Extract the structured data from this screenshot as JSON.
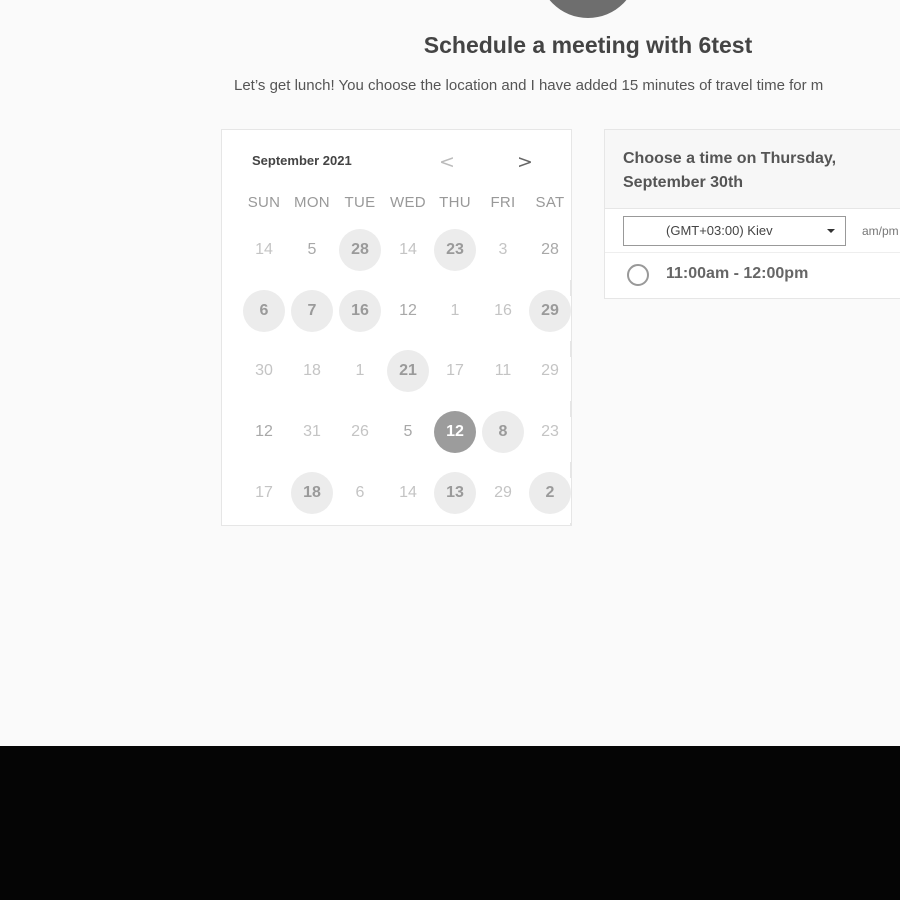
{
  "header": {
    "title": "Schedule a meeting with 6test",
    "subtitle": "Let’s get lunch! You choose the location and I have added 15 minutes of travel time for m"
  },
  "calendar": {
    "month_label": "September 2021",
    "prev_icon": "chevron-left-icon",
    "next_icon": "chevron-right-icon",
    "prev_glyph": "<",
    "next_glyph": ">",
    "weekdays": [
      "SUN",
      "MON",
      "TUE",
      "WED",
      "THU",
      "FRI",
      "SAT"
    ],
    "weeks": [
      [
        {
          "label": "14",
          "state": "muted"
        },
        {
          "label": "5",
          "state": "plain"
        },
        {
          "label": "28",
          "state": "available"
        },
        {
          "label": "14",
          "state": "muted"
        },
        {
          "label": "23",
          "state": "available"
        },
        {
          "label": "3",
          "state": "muted"
        },
        {
          "label": "28",
          "state": "plain"
        }
      ],
      [
        {
          "label": "6",
          "state": "available"
        },
        {
          "label": "7",
          "state": "available"
        },
        {
          "label": "16",
          "state": "available"
        },
        {
          "label": "12",
          "state": "plain"
        },
        {
          "label": "1",
          "state": "muted"
        },
        {
          "label": "16",
          "state": "muted"
        },
        {
          "label": "29",
          "state": "available"
        }
      ],
      [
        {
          "label": "30",
          "state": "muted"
        },
        {
          "label": "18",
          "state": "muted"
        },
        {
          "label": "1",
          "state": "muted"
        },
        {
          "label": "21",
          "state": "available"
        },
        {
          "label": "17",
          "state": "muted"
        },
        {
          "label": "11",
          "state": "muted"
        },
        {
          "label": "29",
          "state": "muted"
        }
      ],
      [
        {
          "label": "12",
          "state": "plain"
        },
        {
          "label": "31",
          "state": "muted"
        },
        {
          "label": "26",
          "state": "muted"
        },
        {
          "label": "5",
          "state": "plain"
        },
        {
          "label": "12",
          "state": "selected"
        },
        {
          "label": "8",
          "state": "available"
        },
        {
          "label": "23",
          "state": "muted"
        }
      ],
      [
        {
          "label": "17",
          "state": "muted"
        },
        {
          "label": "18",
          "state": "available"
        },
        {
          "label": "6",
          "state": "muted"
        },
        {
          "label": "14",
          "state": "muted"
        },
        {
          "label": "13",
          "state": "available"
        },
        {
          "label": "29",
          "state": "muted"
        },
        {
          "label": "2",
          "state": "available"
        }
      ]
    ]
  },
  "time_panel": {
    "heading": "Choose a time on Thursday, September 30th",
    "timezone_value": "(GMT+03:00) Kiev",
    "format_label": "am/pm",
    "slots": [
      {
        "label": "11:00am - 12:00pm",
        "selected": false
      }
    ]
  },
  "colors": {
    "page_bg": "#fafafa",
    "available_bg": "#ececec",
    "selected_bg": "#9c9c9c",
    "title_text": "#444444"
  }
}
